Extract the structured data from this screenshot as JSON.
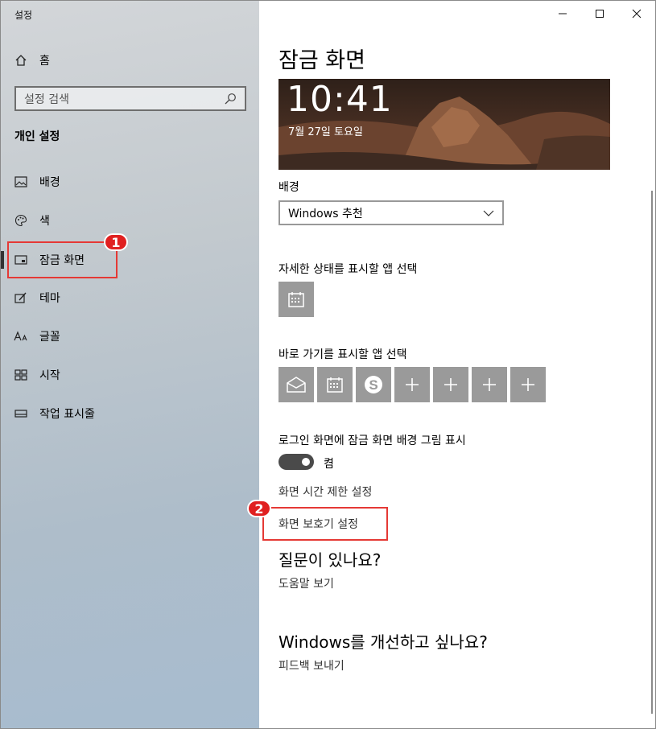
{
  "window": {
    "title": "설정"
  },
  "sidebar": {
    "home_label": "홈",
    "search_placeholder": "설정 검색",
    "section_title": "개인 설정",
    "items": [
      {
        "label": "배경",
        "icon": "picture-icon"
      },
      {
        "label": "색",
        "icon": "palette-icon"
      },
      {
        "label": "잠금 화면",
        "icon": "lock-screen-icon",
        "selected": true
      },
      {
        "label": "테마",
        "icon": "theme-icon"
      },
      {
        "label": "글꼴",
        "icon": "font-icon"
      },
      {
        "label": "시작",
        "icon": "start-icon"
      },
      {
        "label": "작업 표시줄",
        "icon": "taskbar-icon"
      }
    ]
  },
  "callouts": {
    "one": "1",
    "two": "2",
    "color": "#e53935"
  },
  "main": {
    "page_title": "잠금 화면",
    "preview": {
      "time": "10:41",
      "date": "7월 27일 토요일"
    },
    "background_label": "배경",
    "background_value": "Windows 추천",
    "detailed_status_label": "자세한 상태를 표시할 앱 선택",
    "quick_status_label": "바로 가기를 표시할 앱 선택",
    "signin_label": "로그인 화면에 잠금 화면 배경 그림 표시",
    "toggle_state": "켬",
    "toggle_on": true,
    "link_timeout": "화면 시간 제한 설정",
    "link_screensaver": "화면 보호기 설정",
    "question_title": "질문이 있나요?",
    "help_link": "도움말 보기",
    "improve_title": "Windows를 개선하고 싶나요?",
    "feedback_link": "피드백 보내기"
  },
  "colors": {
    "tile": "#9a9a9a",
    "toggle": "#4a4a4a",
    "accent_red": "#e02020"
  }
}
